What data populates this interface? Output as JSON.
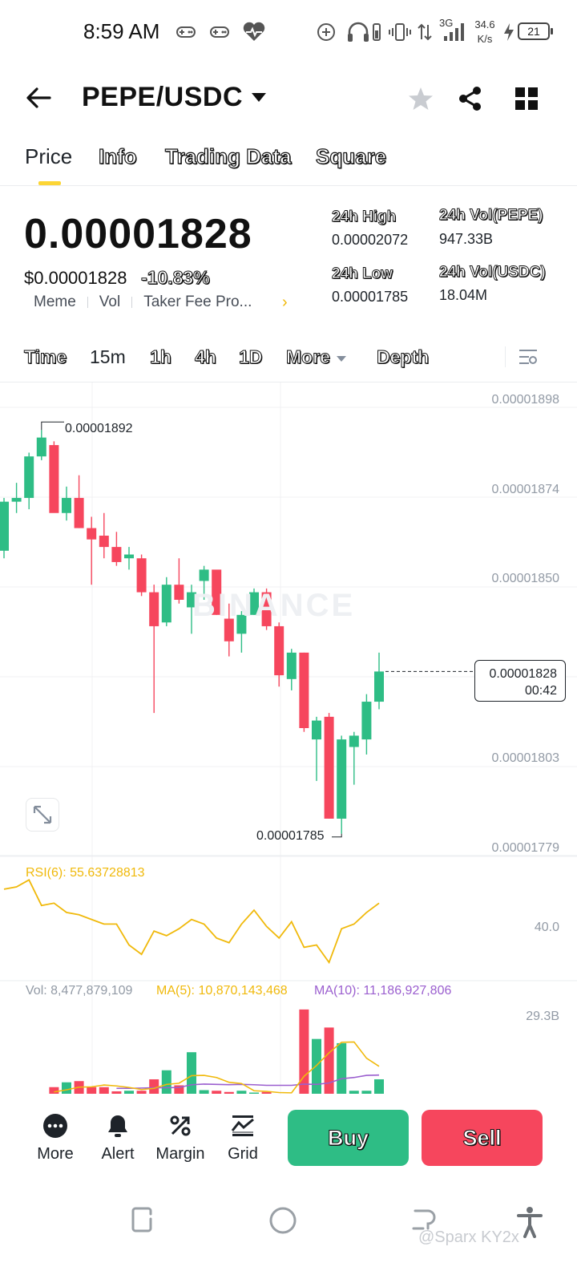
{
  "status_bar": {
    "time": "8:59 AM",
    "network": "3G",
    "speed_value": "34.6",
    "speed_unit": "K/s",
    "battery": "21",
    "icons": [
      "gamepad-icon",
      "gamepad-icon",
      "heart-pulse-icon",
      "add-circle-icon",
      "headphones-battery-icon",
      "vibrate-icon",
      "data-arrows-icon",
      "signal-icon",
      "charging-icon"
    ]
  },
  "header": {
    "title": "PEPE/USDC",
    "icons": [
      "back-arrow-icon",
      "caret-down-icon",
      "star-icon",
      "share-icon",
      "grid-icon"
    ]
  },
  "tabs": [
    {
      "label": "Price",
      "active": true
    },
    {
      "label": "Info",
      "active": false
    },
    {
      "label": "Trading Data",
      "active": false
    },
    {
      "label": "Square",
      "active": false
    }
  ],
  "ticker": {
    "last_price": "0.00001828",
    "usd_price": "$0.00001828",
    "change_pct": "-10.83%",
    "tags": [
      "Meme",
      "Vol",
      "Taker Fee Pro..."
    ],
    "tags_more": "›",
    "stats": {
      "high_label": "24h High",
      "high_value": "0.00002072",
      "low_label": "24h Low",
      "low_value": "0.00001785",
      "vol_base_label": "24h Vol(PEPE)",
      "vol_base_value": "947.33B",
      "vol_quote_label": "24h Vol(USDC)",
      "vol_quote_value": "18.04M"
    }
  },
  "interval_bar": {
    "time": "Time",
    "m15": "15m",
    "h1": "1h",
    "h4": "4h",
    "d1": "1D",
    "more": "More",
    "depth": "Depth",
    "selected": "15m"
  },
  "chart": {
    "watermark": "BINANCE",
    "price_axis": [
      "0.00001898",
      "0.00001874",
      "0.00001850",
      "0.00001803",
      "0.00001779"
    ],
    "current_price": "0.00001828",
    "countdown": "00:42",
    "high_marker": "0.00001892",
    "low_marker": "0.00001785",
    "rsi_label": "RSI(6): 55.63728813",
    "rsi_axis": "40.0",
    "vol_label": "Vol: 8,477,879,109",
    "ma5_label": "MA(5): 10,870,143,468",
    "ma10_label": "MA(10): 11,186,927,806",
    "vol_axis": "29.3B",
    "colors": {
      "up": "#2ebd85",
      "down": "#f6465d",
      "rsi": "#f0b90b",
      "ma5": "#f0b90b",
      "ma10": "#9b5fcf"
    }
  },
  "chart_data": {
    "type": "candlestick",
    "candles": [
      {
        "o": 1.86e-05,
        "h": 1.874e-05,
        "l": 1.858e-05,
        "c": 1.873e-05
      },
      {
        "o": 1.873e-05,
        "h": 1.878e-05,
        "l": 1.87e-05,
        "c": 1.874e-05
      },
      {
        "o": 1.874e-05,
        "h": 1.886e-05,
        "l": 1.871e-05,
        "c": 1.885e-05
      },
      {
        "o": 1.885e-05,
        "h": 1.892e-05,
        "l": 1.884e-05,
        "c": 1.89e-05
      },
      {
        "o": 1.888e-05,
        "h": 1.889e-05,
        "l": 1.871e-05,
        "c": 1.87e-05
      },
      {
        "o": 1.87e-05,
        "h": 1.877e-05,
        "l": 1.868e-05,
        "c": 1.874e-05
      },
      {
        "o": 1.874e-05,
        "h": 1.88e-05,
        "l": 1.866e-05,
        "c": 1.866e-05
      },
      {
        "o": 1.866e-05,
        "h": 1.869e-05,
        "l": 1.851e-05,
        "c": 1.863e-05
      },
      {
        "o": 1.864e-05,
        "h": 1.87e-05,
        "l": 1.858e-05,
        "c": 1.861e-05
      },
      {
        "o": 1.861e-05,
        "h": 1.865e-05,
        "l": 1.856e-05,
        "c": 1.857e-05
      },
      {
        "o": 1.858e-05,
        "h": 1.861e-05,
        "l": 1.855e-05,
        "c": 1.859e-05
      },
      {
        "o": 1.858e-05,
        "h": 1.859e-05,
        "l": 1.848e-05,
        "c": 1.849e-05
      },
      {
        "o": 1.849e-05,
        "h": 1.851e-05,
        "l": 1.817e-05,
        "c": 1.84e-05
      },
      {
        "o": 1.841e-05,
        "h": 1.853e-05,
        "l": 1.84e-05,
        "c": 1.851e-05
      },
      {
        "o": 1.851e-05,
        "h": 1.858e-05,
        "l": 1.846e-05,
        "c": 1.847e-05
      },
      {
        "o": 1.845e-05,
        "h": 1.851e-05,
        "l": 1.838e-05,
        "c": 1.849e-05
      },
      {
        "o": 1.852e-05,
        "h": 1.856e-05,
        "l": 1.847e-05,
        "c": 1.855e-05
      },
      {
        "o": 1.855e-05,
        "h": 1.854e-05,
        "l": 1.843e-05,
        "c": 1.843e-05
      },
      {
        "o": 1.842e-05,
        "h": 1.846e-05,
        "l": 1.832e-05,
        "c": 1.836e-05
      },
      {
        "o": 1.838e-05,
        "h": 1.844e-05,
        "l": 1.833e-05,
        "c": 1.843e-05
      },
      {
        "o": 1.843e-05,
        "h": 1.85e-05,
        "l": 1.843e-05,
        "c": 1.849e-05
      },
      {
        "o": 1.849e-05,
        "h": 1.85e-05,
        "l": 1.839e-05,
        "c": 1.84e-05
      },
      {
        "o": 1.84e-05,
        "h": 1.841e-05,
        "l": 1.824e-05,
        "c": 1.827e-05
      },
      {
        "o": 1.826e-05,
        "h": 1.834e-05,
        "l": 1.823e-05,
        "c": 1.833e-05
      },
      {
        "o": 1.833e-05,
        "h": 1.833e-05,
        "l": 1.812e-05,
        "c": 1.813e-05
      },
      {
        "o": 1.81e-05,
        "h": 1.816e-05,
        "l": 1.799e-05,
        "c": 1.815e-05
      },
      {
        "o": 1.816e-05,
        "h": 1.817e-05,
        "l": 1.789e-05,
        "c": 1.789e-05
      },
      {
        "o": 1.789e-05,
        "h": 1.811e-05,
        "l": 1.785e-05,
        "c": 1.81e-05
      },
      {
        "o": 1.808e-05,
        "h": 1.812e-05,
        "l": 1.798e-05,
        "c": 1.811e-05
      },
      {
        "o": 1.81e-05,
        "h": 1.822e-05,
        "l": 1.806e-05,
        "c": 1.82e-05
      },
      {
        "o": 1.82e-05,
        "h": 1.833e-05,
        "l": 1.818e-05,
        "c": 1.828e-05
      }
    ],
    "rsi": [
      78,
      80,
      86,
      64,
      66,
      58,
      56,
      52,
      48,
      48,
      30,
      22,
      42,
      38,
      44,
      52,
      48,
      36,
      32,
      48,
      60,
      46,
      36,
      50,
      28,
      30,
      15,
      44,
      48,
      58,
      66
    ],
    "volumes": [
      0.0,
      0.0,
      0.0,
      0.0,
      2.2,
      3.8,
      4.2,
      2.2,
      2.2,
      0.8,
      1.0,
      1.0,
      4.8,
      7.8,
      2.8,
      13.8,
      1.2,
      1.0,
      0.6,
      1.0,
      0.4,
      0.6,
      0.0,
      0.0,
      28.0,
      18.2,
      22.0,
      16.8,
      1.0,
      1.0,
      4.8
    ],
    "ma5": [
      null,
      null,
      null,
      null,
      0.6,
      1.3,
      2.2,
      2.3,
      2.9,
      2.6,
      2.1,
      1.4,
      1.8,
      3.1,
      3.5,
      6.0,
      6.1,
      5.4,
      3.8,
      3.4,
      1.0,
      0.8,
      0.4,
      0.3,
      5.8,
      9.4,
      13.6,
      17.1,
      17.2,
      11.8,
      9.1
    ],
    "ma10": [
      null,
      null,
      null,
      null,
      null,
      null,
      null,
      null,
      null,
      1.8,
      1.8,
      1.9,
      2.0,
      2.0,
      2.1,
      3.0,
      3.2,
      3.1,
      3.0,
      3.1,
      3.0,
      2.8,
      2.8,
      2.8,
      3.2,
      3.1,
      3.6,
      5.0,
      5.4,
      6.1,
      6.2
    ],
    "y_range": [
      1.779e-05,
      1.898e-05
    ],
    "grid": true,
    "title": "",
    "xlabel": "",
    "ylabel": ""
  },
  "bottom_bar": {
    "items": [
      {
        "label": "More",
        "icon": "more-dots-icon"
      },
      {
        "label": "Alert",
        "icon": "bell-icon"
      },
      {
        "label": "Margin",
        "icon": "margin-icon"
      },
      {
        "label": "Grid",
        "icon": "grid-trading-icon"
      }
    ],
    "buy": "Buy",
    "sell": "Sell"
  },
  "nav_bar": {
    "icons": [
      "recents-icon",
      "home-icon",
      "back-icon",
      "accessibility-icon"
    ],
    "credit": "@Sparx KY2x"
  }
}
